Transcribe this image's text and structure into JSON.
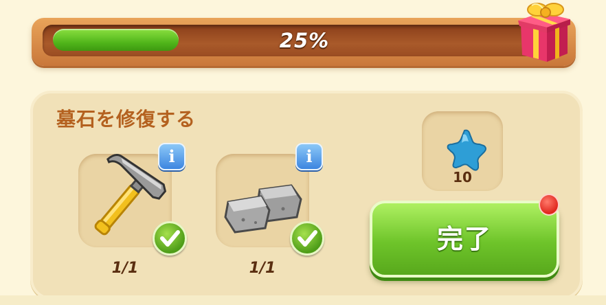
{
  "progress": {
    "percent_label": "25%",
    "value": 0.25,
    "reward_icon": "gift-box-icon"
  },
  "task": {
    "title": "墓石を修復する",
    "requirements": [
      {
        "icon": "hammer-icon",
        "count": "1/1",
        "info_icon": "info-icon",
        "status_icon": "checkmark-icon"
      },
      {
        "icon": "stone-blocks-icon",
        "count": "1/1",
        "info_icon": "info-icon",
        "status_icon": "checkmark-icon"
      }
    ],
    "info_label": "i",
    "reward": {
      "icon": "blue-star-icon",
      "amount": "10"
    },
    "complete_button": {
      "label": "完了",
      "badge": "notification-dot"
    }
  },
  "colors": {
    "progress_fill": "#4fb41a",
    "title": "#b4611f",
    "button": "#6ec42a",
    "notification": "#e0261d",
    "reward_star": "#2e9ed6"
  }
}
